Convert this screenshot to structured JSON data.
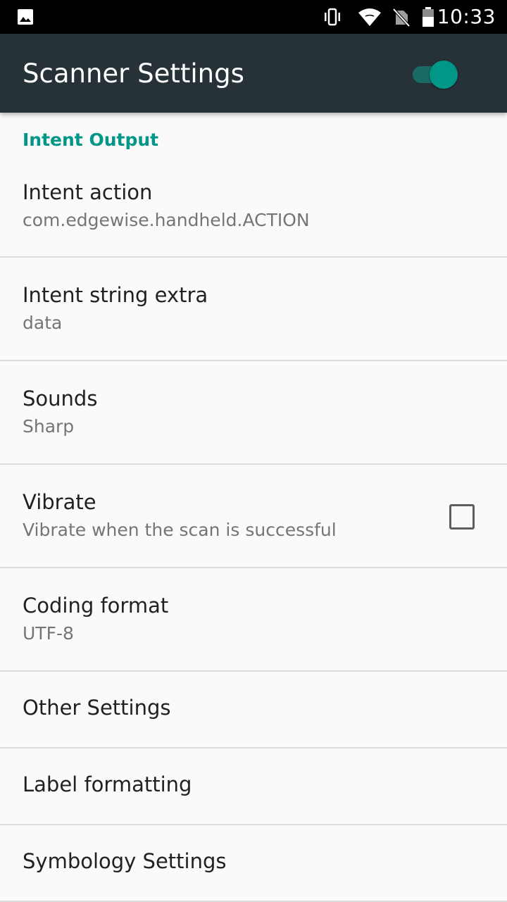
{
  "status_bar": {
    "time": "10:33",
    "icons": [
      "gallery-icon",
      "vibrate-icon",
      "wifi-icon",
      "no-sim-icon",
      "battery-icon"
    ]
  },
  "app_bar": {
    "title": "Scanner Settings",
    "master_switch_on": true
  },
  "category": {
    "title": "Intent Output"
  },
  "preferences": [
    {
      "title": "Intent action",
      "summary": "com.edgewise.handheld.ACTION"
    },
    {
      "title": "Intent string extra",
      "summary": "data"
    },
    {
      "title": "Sounds",
      "summary": "Sharp"
    },
    {
      "title": "Vibrate",
      "summary": "Vibrate when the scan is successful",
      "checked": false
    },
    {
      "title": "Coding format",
      "summary": "UTF-8"
    },
    {
      "title": "Other Settings"
    },
    {
      "title": "Label formatting"
    },
    {
      "title": "Symbology Settings"
    }
  ],
  "colors": {
    "accent": "#009688",
    "app_bar": "#263238",
    "background": "#fafafa",
    "divider": "#dcdcdc"
  }
}
